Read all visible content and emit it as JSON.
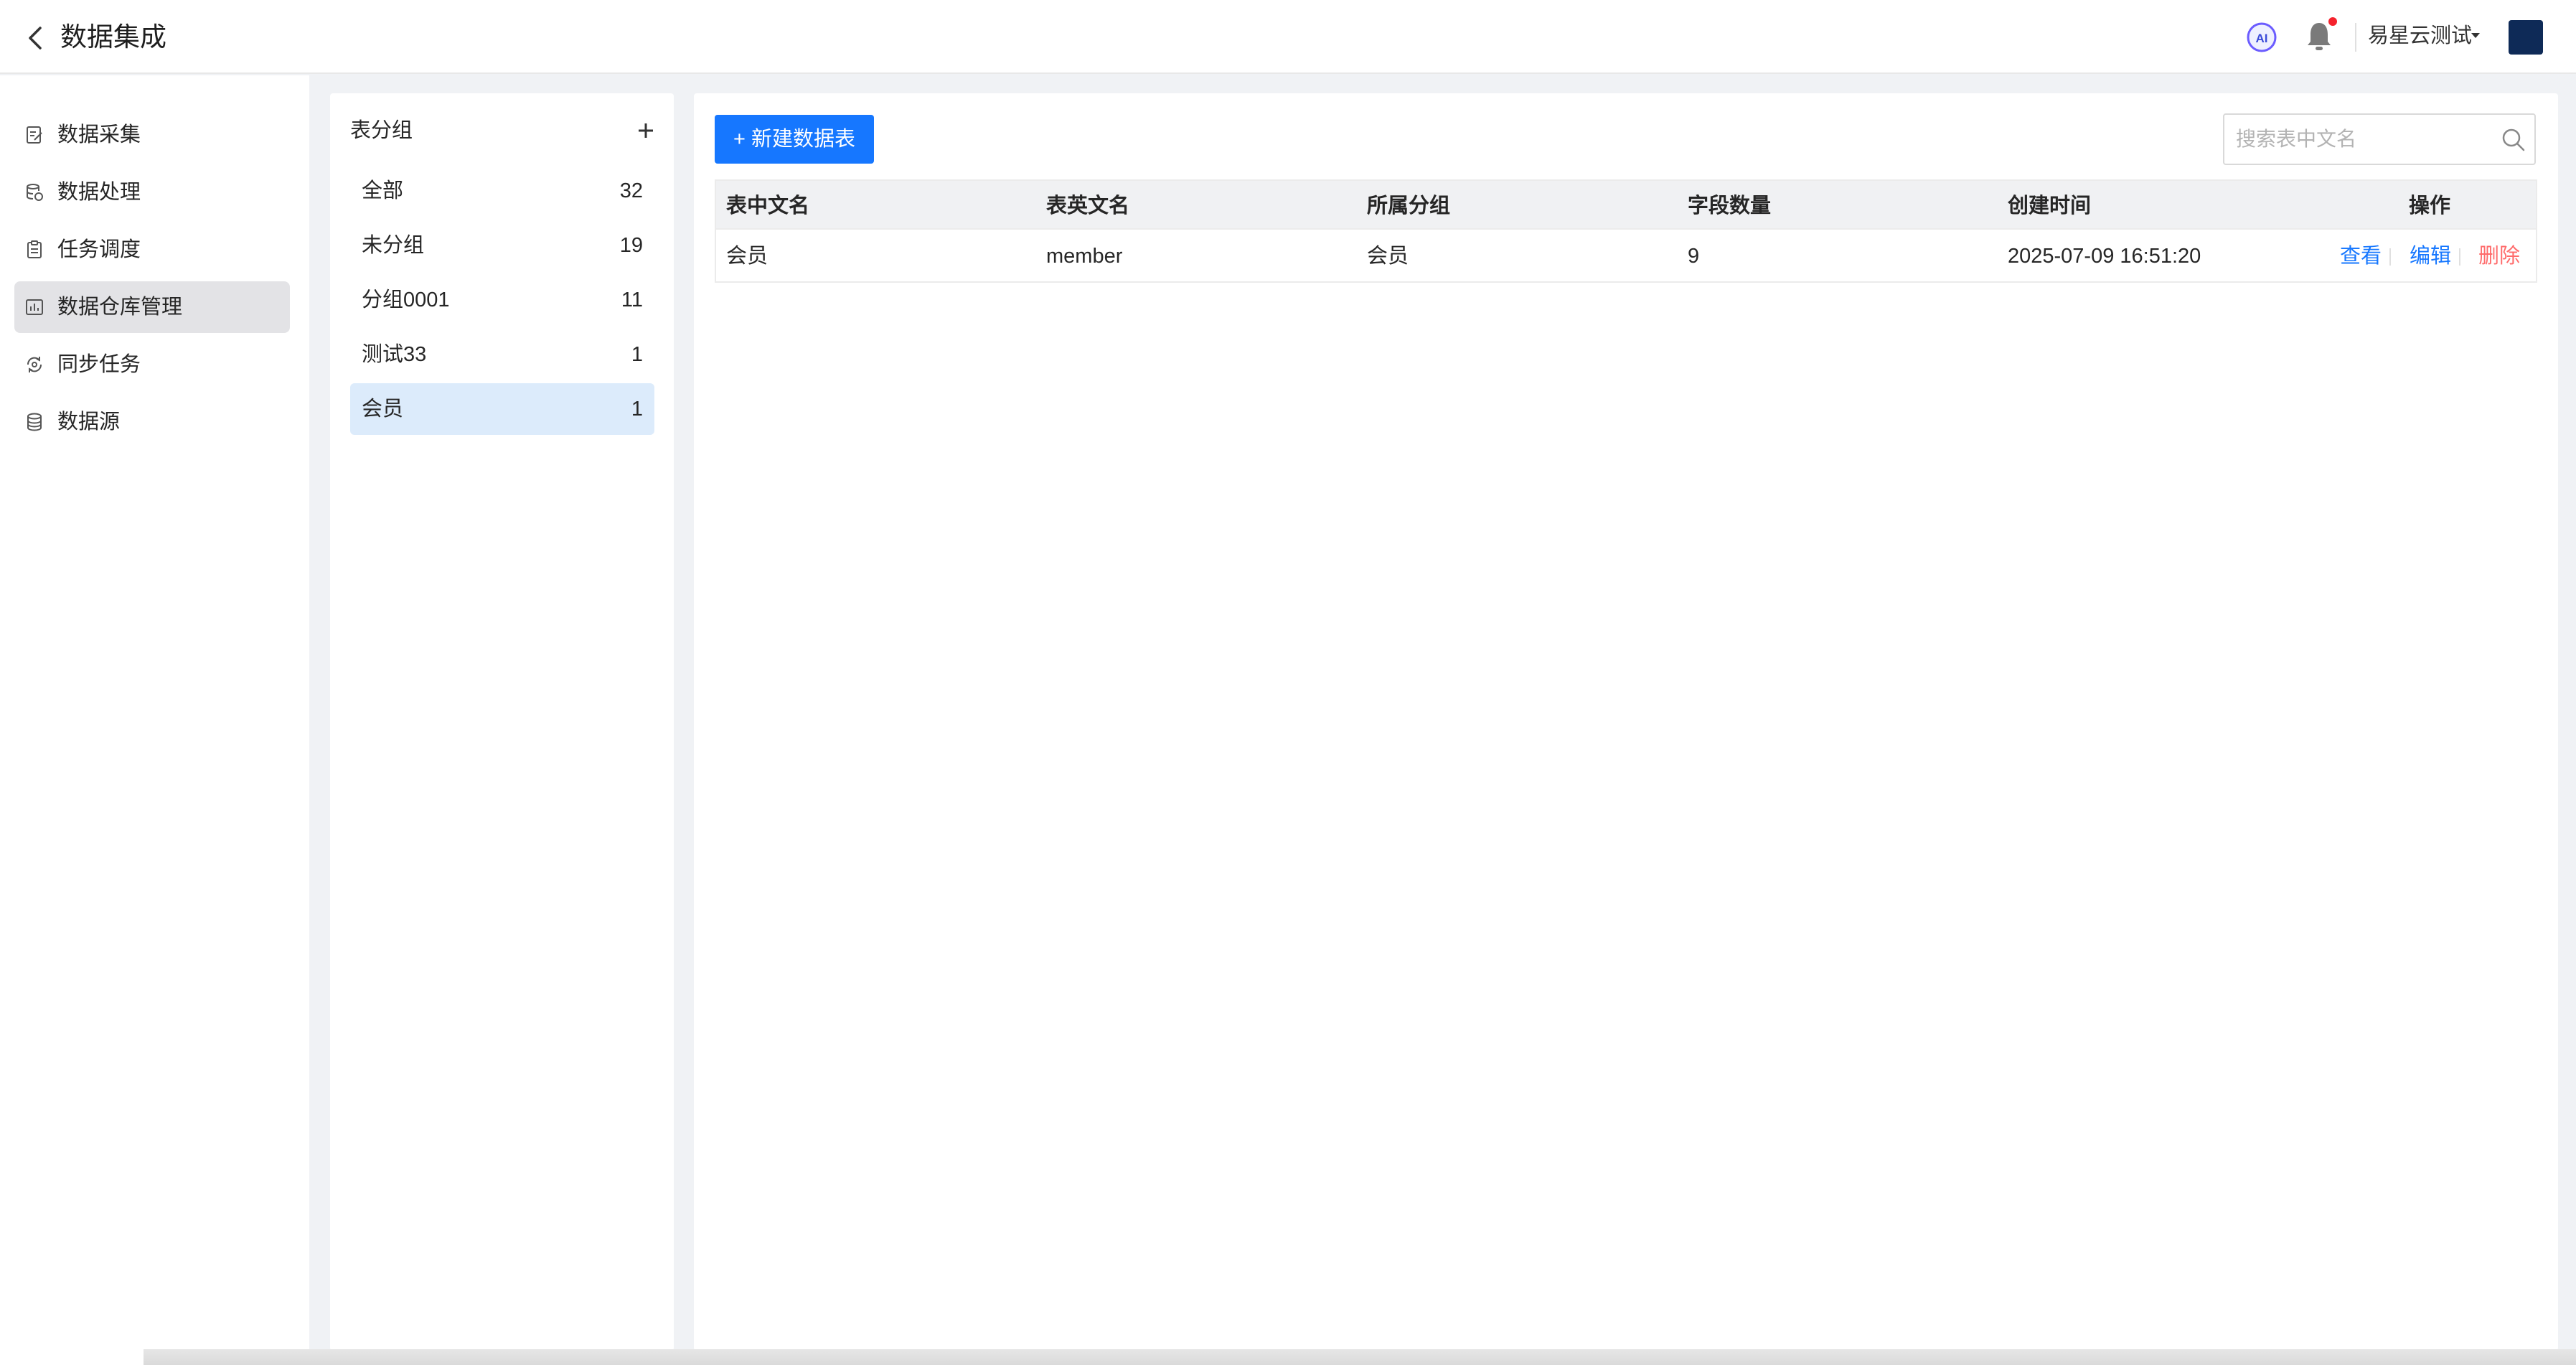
{
  "app": {
    "title": "数据集成"
  },
  "header": {
    "ai_icon": "ai-icon",
    "bell_icon": "bell-icon",
    "user_name": "易星云测试"
  },
  "sidebar": {
    "items": [
      {
        "label": "数据采集",
        "icon": "document-edit-icon"
      },
      {
        "label": "数据处理",
        "icon": "database-process-icon"
      },
      {
        "label": "任务调度",
        "icon": "clipboard-icon"
      },
      {
        "label": "数据仓库管理",
        "icon": "chart-icon",
        "active": true
      },
      {
        "label": "同步任务",
        "icon": "sync-icon"
      },
      {
        "label": "数据源",
        "icon": "database-icon"
      }
    ]
  },
  "groups": {
    "title": "表分组",
    "add_icon": "plus-icon",
    "items": [
      {
        "name": "全部",
        "count": "32"
      },
      {
        "name": "未分组",
        "count": "19"
      },
      {
        "name": "分组0001",
        "count": "11"
      },
      {
        "name": "测试33",
        "count": "1"
      },
      {
        "name": "会员",
        "count": "1",
        "active": true
      }
    ]
  },
  "toolbar": {
    "new_button": "+ 新建数据表",
    "search_placeholder": "搜索表中文名"
  },
  "table": {
    "headers": [
      "表中文名",
      "表英文名",
      "所属分组",
      "字段数量",
      "创建时间",
      "操作"
    ],
    "rows": [
      {
        "cn_name": "会员",
        "en_name": "member",
        "group": "会员",
        "field_count": "9",
        "created": "2025-07-09 16:51:20",
        "actions": [
          "查看",
          "编辑",
          "删除"
        ]
      }
    ]
  },
  "colors": {
    "primary": "#1677ff",
    "danger": "#ff6b6b",
    "active_group_bg": "#dcebfb",
    "active_nav_bg": "#e3e3e6"
  }
}
